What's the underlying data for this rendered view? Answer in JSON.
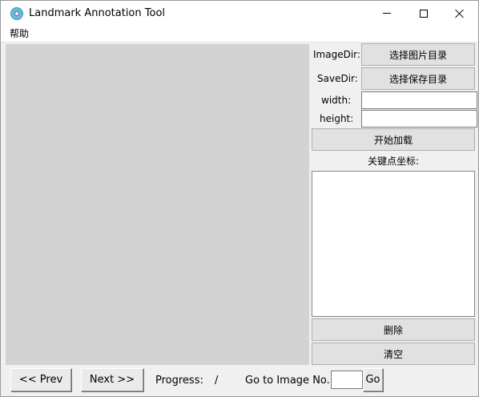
{
  "window": {
    "title": "Landmark Annotation Tool",
    "minimize_label": "minimize",
    "maximize_label": "maximize",
    "close_label": "close"
  },
  "menu": {
    "items": [
      "帮助"
    ]
  },
  "panel": {
    "image_dir_label": "ImageDir:",
    "image_dir_button": "选择图片目录",
    "save_dir_label": "SaveDir:",
    "save_dir_button": "选择保存目录",
    "width_label": "width:",
    "width_value": "",
    "height_label": "height:",
    "height_value": "",
    "load_button": "开始加载",
    "keypoints_label": "关键点坐标:",
    "keypoints": [],
    "delete_button": "删除",
    "clear_button": "清空"
  },
  "bottom": {
    "prev_button": "<< Prev",
    "next_button": "Next >>",
    "progress_label": "Progress:",
    "progress_value": "/",
    "goto_label": "Go to Image No.",
    "goto_value": "",
    "go_button": "Go"
  }
}
